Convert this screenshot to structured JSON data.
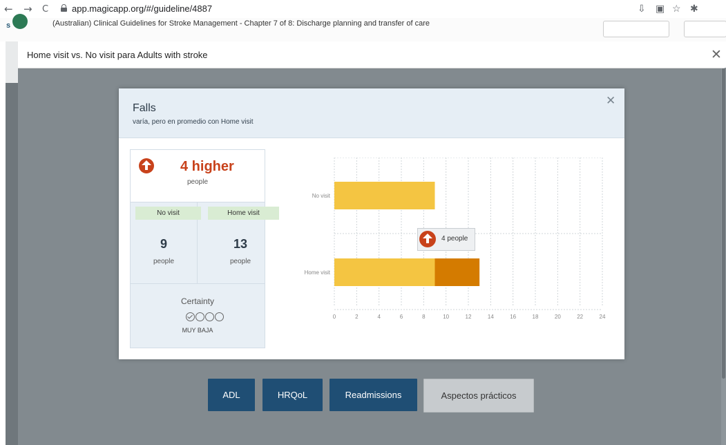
{
  "browser": {
    "back": "←",
    "forward": "→",
    "reload": "C",
    "url": "app.magicapp.org/#/guideline/4887"
  },
  "site": {
    "title": "(Australian) Clinical Guidelines for Stroke Management - Chapter 7 of 8: Discharge planning and transfer of care",
    "logo_letter": "s"
  },
  "outer_modal": {
    "title": "Home visit vs. No visit para Adults with stroke",
    "close": "✕"
  },
  "modal": {
    "title": "Falls",
    "subtitle": "varía, pero en promedio con Home visit",
    "close": "✕",
    "effect": {
      "value": "4 higher",
      "unit": "people",
      "direction_icon": "arrow-up-circle-icon",
      "color": "#c8421b"
    },
    "comparator": {
      "label": "No visit",
      "value": "9",
      "unit": "people"
    },
    "intervention": {
      "label": "Home visit",
      "value": "13",
      "unit": "people"
    },
    "certainty": {
      "label": "Certainty",
      "filled": 1,
      "total": 4,
      "grade": "MUY BAJA"
    },
    "tooltip": {
      "text": "4 people"
    }
  },
  "chart_data": {
    "type": "bar",
    "orientation": "horizontal",
    "categories": [
      "No visit",
      "Home visit"
    ],
    "series": [
      {
        "values": [
          9,
          9
        ],
        "color": "#f4c542"
      },
      {
        "values": [
          0,
          4
        ],
        "color": "#d47b00"
      }
    ],
    "xlim": [
      0,
      24
    ],
    "xticks": [
      0,
      2,
      4,
      6,
      8,
      10,
      12,
      14,
      16,
      18,
      20,
      22,
      24
    ],
    "grid": true
  },
  "tabs": [
    {
      "label": "ADL"
    },
    {
      "label": "HRQoL"
    },
    {
      "label": "Readmissions"
    },
    {
      "label": "Aspectos prácticos"
    }
  ]
}
